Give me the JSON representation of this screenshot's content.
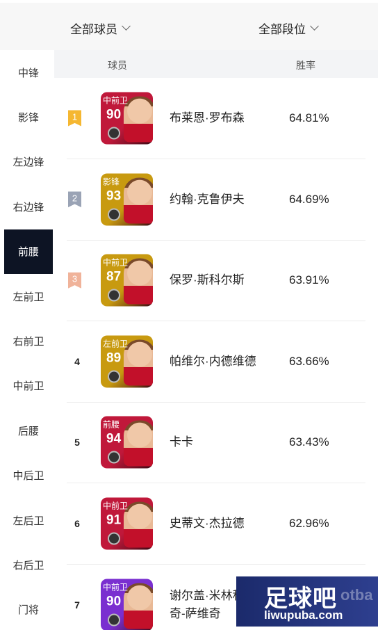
{
  "filters": {
    "player": "全部球员",
    "rank": "全部段位"
  },
  "table_header": {
    "player": "球员",
    "win_rate": "胜率"
  },
  "sidebar": {
    "active_index": 4,
    "items": [
      {
        "label": "中锋"
      },
      {
        "label": "影锋"
      },
      {
        "label": "左边锋"
      },
      {
        "label": "右边锋"
      },
      {
        "label": "前腰"
      },
      {
        "label": "左前卫"
      },
      {
        "label": "右前卫"
      },
      {
        "label": "中前卫"
      },
      {
        "label": "后腰"
      },
      {
        "label": "中后卫"
      },
      {
        "label": "左后卫"
      },
      {
        "label": "右后卫"
      },
      {
        "label": "门将"
      }
    ]
  },
  "players": [
    {
      "rank": "1",
      "badge_color": "#f5b731",
      "card_color": "#c0183a",
      "position": "中前卫",
      "rating": "90",
      "name": "布莱恩·罗布森",
      "win_rate": "64.81%"
    },
    {
      "rank": "2",
      "badge_color": "#9aa3b5",
      "card_color": "#c89a10",
      "position": "影锋",
      "rating": "93",
      "name": "约翰·克鲁伊夫",
      "win_rate": "64.69%"
    },
    {
      "rank": "3",
      "badge_color": "#f0b39a",
      "card_color": "#c89a10",
      "position": "中前卫",
      "rating": "87",
      "name": "保罗·斯科尔斯",
      "win_rate": "63.91%"
    },
    {
      "rank": "4",
      "badge_color": "",
      "card_color": "#c89a10",
      "position": "左前卫",
      "rating": "89",
      "name": "帕维尔·内德维德",
      "win_rate": "63.66%"
    },
    {
      "rank": "5",
      "badge_color": "",
      "card_color": "#c0183a",
      "position": "前腰",
      "rating": "94",
      "name": "卡卡",
      "win_rate": "63.43%"
    },
    {
      "rank": "6",
      "badge_color": "",
      "card_color": "#c0183a",
      "position": "中前卫",
      "rating": "91",
      "name": "史蒂文·杰拉德",
      "win_rate": "62.96%"
    },
    {
      "rank": "7",
      "badge_color": "",
      "card_color": "#7a2fd0",
      "position": "中前卫",
      "rating": "90",
      "name": "谢尔盖·米林科维奇-萨维奇",
      "win_rate": ""
    }
  ],
  "watermark": {
    "logo": "足球吧",
    "url": "liwupuba.com",
    "bg_text": "otba"
  }
}
